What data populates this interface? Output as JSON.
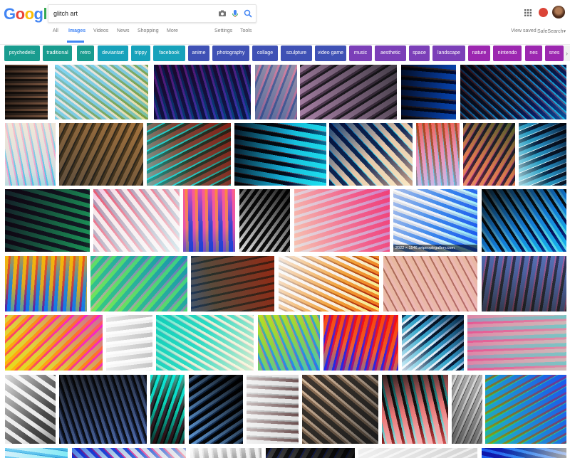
{
  "logo": {
    "text": "Google",
    "letters": [
      "G",
      "o",
      "o",
      "g",
      "l",
      "e"
    ],
    "colors": [
      "#4285f4",
      "#ea4335",
      "#fbbc05",
      "#4285f4",
      "#34a853",
      "#ea4335"
    ]
  },
  "search": {
    "query": "glitch art",
    "icons": [
      "camera-icon",
      "microphone-icon",
      "search-icon"
    ]
  },
  "nav": {
    "tabs": [
      "All",
      "Images",
      "Videos",
      "News",
      "Shopping",
      "More"
    ],
    "active": "Images",
    "settings": "Settings",
    "tools": "Tools",
    "view_saved": "View saved",
    "safesearch": "SafeSearch",
    "safesearch_arrow": "▾"
  },
  "account": {
    "notification_badge": ""
  },
  "chips": [
    {
      "label": "psychedelic",
      "color": "#199c8f"
    },
    {
      "label": "traditional",
      "color": "#199c8f"
    },
    {
      "label": "retro",
      "color": "#199c8f"
    },
    {
      "label": "deviantart",
      "color": "#17a2bb"
    },
    {
      "label": "trippy",
      "color": "#17a2bb"
    },
    {
      "label": "facebook",
      "color": "#17a2bb"
    },
    {
      "label": "anime",
      "color": "#3f51b5"
    },
    {
      "label": "photography",
      "color": "#3f51b5"
    },
    {
      "label": "collage",
      "color": "#3f51b5"
    },
    {
      "label": "sculpture",
      "color": "#3f51b5"
    },
    {
      "label": "video game",
      "color": "#3f51b5"
    },
    {
      "label": "music",
      "color": "#7b3fb8"
    },
    {
      "label": "aesthetic",
      "color": "#7b3fb8"
    },
    {
      "label": "space",
      "color": "#7b3fb8"
    },
    {
      "label": "landscape",
      "color": "#7b3fb8"
    },
    {
      "label": "nature",
      "color": "#9c27b0"
    },
    {
      "label": "nintendo",
      "color": "#9c27b0"
    },
    {
      "label": "nes",
      "color": "#9c27b0"
    },
    {
      "label": "snes",
      "color": "#9c27b0"
    }
  ],
  "chips_next": "›",
  "results": [
    {
      "c1": "#2a2420",
      "c2": "#a98870",
      "c3": "#5c5048"
    },
    {
      "c1": "#7fb6d8",
      "c2": "#e9d7c7",
      "c3": "#7d8f5a"
    },
    {
      "c1": "#3b1d4a",
      "c2": "#c24bb0",
      "c3": "#1d5e80"
    },
    {
      "c1": "#8c8896",
      "c2": "#c87c8e",
      "c3": "#526487"
    },
    {
      "c1": "#2b2b2e",
      "c2": "#c9b6c6",
      "c3": "#6b5a6b"
    },
    {
      "c1": "#0c1220",
      "c2": "#cf3d2b",
      "c3": "#1e5f9a"
    },
    {
      "c1": "#1a1a2a",
      "c2": "#d43a3a",
      "c3": "#37a0c4"
    },
    {
      "c1": "#d8c9b8",
      "c2": "#ef6d9a",
      "c3": "#5fa7c9"
    },
    {
      "c1": "#6b5a3d",
      "c2": "#c3a27e",
      "c3": "#3d3d3d"
    },
    {
      "c1": "#4a3a2e",
      "c2": "#e0453a",
      "c3": "#46c2c2"
    },
    {
      "c1": "#0d0d14",
      "c2": "#e03c3c",
      "c3": "#3fc2d6"
    },
    {
      "c1": "#0f2a55",
      "c2": "#25d0e6",
      "c3": "#e6c9a8"
    },
    {
      "c1": "#9c5a3a",
      "c2": "#e88cb6",
      "c3": "#6db3d6"
    },
    {
      "c1": "#2b3a3a",
      "c2": "#d8c45a",
      "c3": "#b35a8c"
    },
    {
      "c1": "#0d1a2a",
      "c2": "#2a8ab0",
      "c3": "#cfe6ea"
    },
    {
      "c1": "#2a1a2e",
      "c2": "#b94a8a",
      "c3": "#3a8a6a"
    },
    {
      "c1": "#c86a78",
      "c2": "#3aa0b0",
      "c3": "#e8e8e8"
    },
    {
      "c1": "#e86c8a",
      "c2": "#f0a030",
      "c3": "#3a5ab8"
    },
    {
      "c1": "#111111",
      "c2": "#eeeeee",
      "c3": "#777777"
    },
    {
      "c1": "#d25a7c",
      "c2": "#7aa6c6",
      "c3": "#e8d2b4"
    },
    {
      "c1": "#c8c8c8",
      "c2": "#f0f0f0",
      "c3": "#3a6ad0"
    },
    {
      "c1": "#111111",
      "c2": "#cfcfcf",
      "c3": "#3aa0d6"
    },
    {
      "c1": "#e0a020",
      "c2": "#c02a4a",
      "c3": "#2a7ad0"
    },
    {
      "c1": "#3a8a9a",
      "c2": "#c86aa8",
      "c3": "#7ac86a"
    },
    {
      "c1": "#5a3a2a",
      "c2": "#d05a3a",
      "c3": "#2a7aa0"
    },
    {
      "c1": "#e8e8e8",
      "c2": "#1a1a1a",
      "c3": "#d07a3a"
    },
    {
      "c1": "#c8a090",
      "c2": "#3a3a3a",
      "c3": "#d0a0a0"
    },
    {
      "c1": "#6a7aa0",
      "c2": "#c86a8a",
      "c3": "#3a3a3a"
    },
    {
      "c1": "#e040b0",
      "c2": "#3ad060",
      "c3": "#f0a020"
    },
    {
      "c1": "#d0d0d0",
      "c2": "#555555",
      "c3": "#f0f0f0"
    },
    {
      "c1": "#2ab0a0",
      "c2": "#c87aa0",
      "c3": "#e8e0c0"
    },
    {
      "c1": "#a0c040",
      "c2": "#e040a0",
      "c3": "#3a80d0"
    },
    {
      "c1": "#e02a2a",
      "c2": "#f0c020",
      "c3": "#3a4ad0"
    },
    {
      "c1": "#0a1a2a",
      "c2": "#3aa0c0",
      "c3": "#e0e8f0"
    },
    {
      "c1": "#b0a0a0",
      "c2": "#2ab0b0",
      "c3": "#c86a8a"
    },
    {
      "c1": "#e8e8e8",
      "c2": "#9a9a9a",
      "c3": "#4a4a4a"
    },
    {
      "c1": "#1a1a1a",
      "c2": "#aab8d0",
      "c3": "#3a4a6a"
    },
    {
      "c1": "#2ad0c0",
      "c2": "#c02a3a",
      "c3": "#1a1a1a"
    },
    {
      "c1": "#0a0a0a",
      "c2": "#d0d8e0",
      "c3": "#3a5a7a"
    },
    {
      "c1": "#d8d8d8",
      "c2": "#5a3a3a",
      "c3": "#8a8a8a"
    },
    {
      "c1": "#8a7a6a",
      "c2": "#d0c8c0",
      "c3": "#3a3a3a"
    },
    {
      "c1": "#1a1a1a",
      "c2": "#2ad0d0",
      "c3": "#e8a0a0"
    },
    {
      "c1": "#9a9a9a",
      "c2": "#d0d0d0",
      "c3": "#4a4a4a"
    },
    {
      "c1": "#3a6ad0",
      "c2": "#e0402a",
      "c3": "#4ac060"
    },
    {
      "c1": "#7ab0d8",
      "c2": "#e0e8f0",
      "c3": "#4a8ab0"
    },
    {
      "c1": "#2a4ab0",
      "c2": "#e02a40",
      "c3": "#d0d0d0"
    },
    {
      "c1": "#e8e8e8",
      "c2": "#bdbdbd",
      "c3": "#8a8a8a"
    },
    {
      "c1": "#1a1a1a",
      "c2": "#2a3a8a",
      "c3": "#5a5a5a"
    },
    {
      "c1": "#cfcfcf",
      "c2": "#8a8a8a",
      "c3": "#eeeeee"
    },
    {
      "c1": "#3a6ad0",
      "c2": "#1a1a1a",
      "c3": "#d0d0d0"
    }
  ],
  "captions": {
    "r19": "2022 × 1546   artpeoplegallery.com"
  }
}
